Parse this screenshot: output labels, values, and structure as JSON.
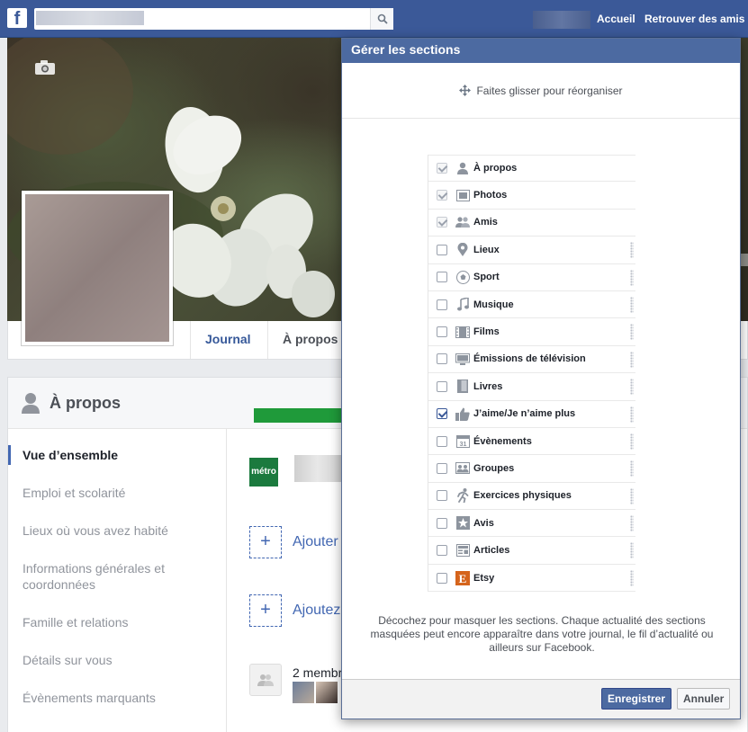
{
  "topbar": {
    "nav_home": "Accueil",
    "nav_find_friends": "Retrouver des amis"
  },
  "profile": {
    "tabs": [
      "Journal",
      "À propos"
    ]
  },
  "about": {
    "title": "À propos",
    "nav": [
      "Vue d’ensemble",
      "Emploi et scolarité",
      "Lieux où vous avez habité",
      "Informations générales et coordonnées",
      "Famille et relations",
      "Détails sur vous",
      "Évènements marquants"
    ],
    "metro_logo": "métro",
    "add_1": "Ajouter",
    "add_2": "Ajoutez",
    "members": "2 membr"
  },
  "modal": {
    "title": "Gérer les sections",
    "drag_hint": "Faites glisser pour réorganiser",
    "sections": [
      {
        "label": "À propos",
        "checked": true,
        "locked": true,
        "icon": "person-icon"
      },
      {
        "label": "Photos",
        "checked": true,
        "locked": true,
        "icon": "photos-icon"
      },
      {
        "label": "Amis",
        "checked": true,
        "locked": true,
        "icon": "friends-icon"
      },
      {
        "label": "Lieux",
        "checked": false,
        "locked": false,
        "icon": "map-pin-icon"
      },
      {
        "label": "Sport",
        "checked": false,
        "locked": false,
        "icon": "sport-icon"
      },
      {
        "label": "Musique",
        "checked": false,
        "locked": false,
        "icon": "music-icon"
      },
      {
        "label": "Films",
        "checked": false,
        "locked": false,
        "icon": "film-icon"
      },
      {
        "label": "Émissions de télévision",
        "checked": false,
        "locked": false,
        "icon": "tv-icon"
      },
      {
        "label": "Livres",
        "checked": false,
        "locked": false,
        "icon": "book-icon"
      },
      {
        "label": "J’aime/Je n’aime plus",
        "checked": true,
        "locked": false,
        "icon": "thumb-icon"
      },
      {
        "label": "Évènements",
        "checked": false,
        "locked": false,
        "icon": "calendar-icon"
      },
      {
        "label": "Groupes",
        "checked": false,
        "locked": false,
        "icon": "groups-icon"
      },
      {
        "label": "Exercices physiques",
        "checked": false,
        "locked": false,
        "icon": "running-icon"
      },
      {
        "label": "Avis",
        "checked": false,
        "locked": false,
        "icon": "star-icon"
      },
      {
        "label": "Articles",
        "checked": false,
        "locked": false,
        "icon": "article-icon"
      },
      {
        "label": "Etsy",
        "checked": false,
        "locked": false,
        "icon": "etsy-icon"
      }
    ],
    "note": "Décochez pour masquer les sections. Chaque actualité des sections masquées peut encore apparaître dans votre journal, le fil d’actualité ou ailleurs sur Facebook.",
    "save_label": "Enregistrer",
    "cancel_label": "Annuler"
  },
  "colors": {
    "brand": "#3b5998",
    "modal_header": "#4c6aa1",
    "arrow": "#1f9a3a"
  }
}
